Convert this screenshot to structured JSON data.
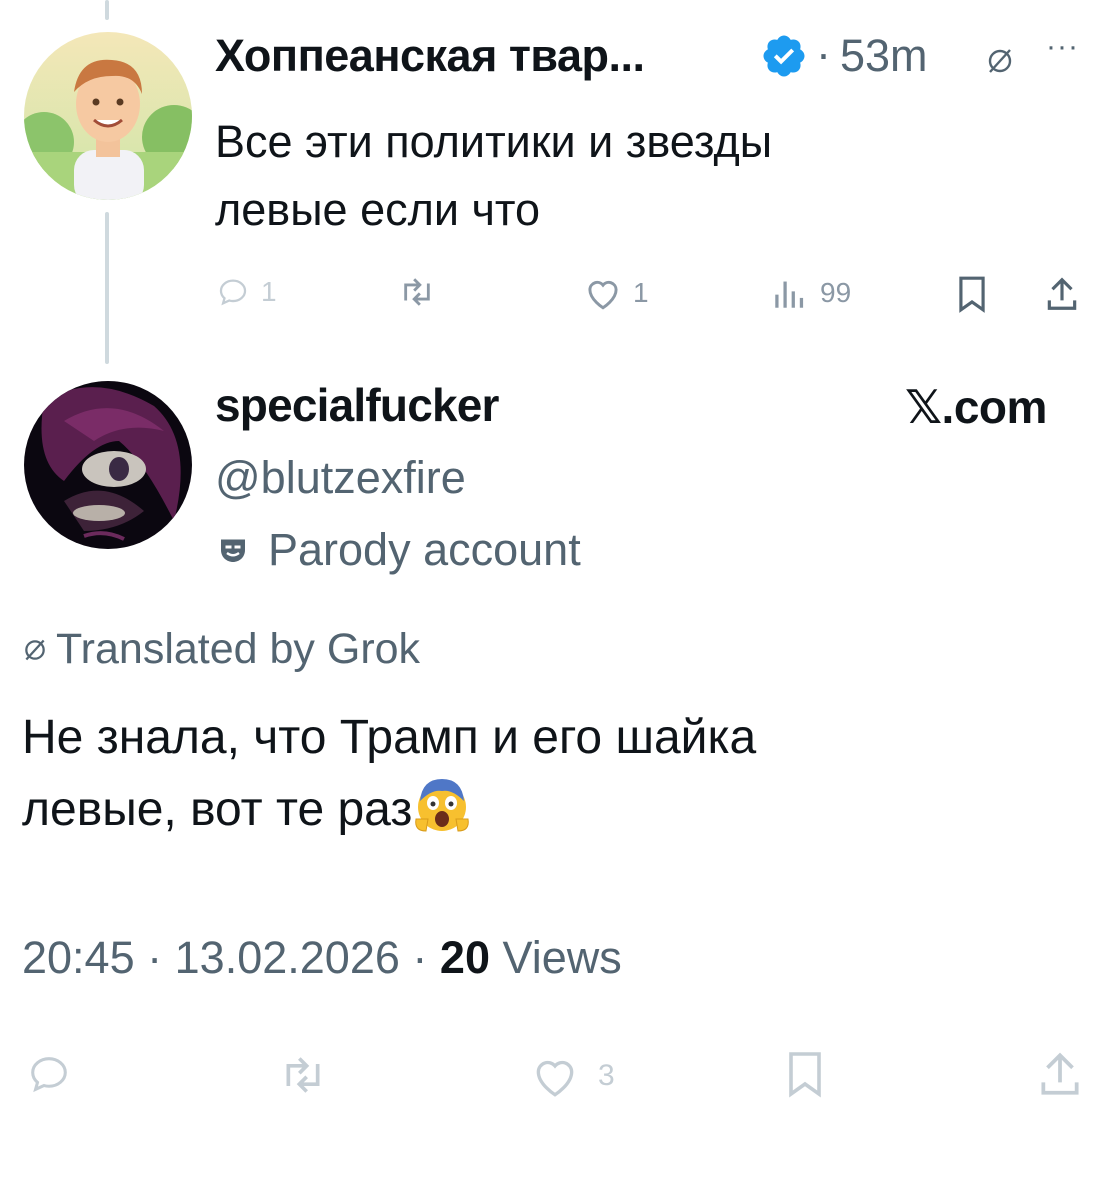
{
  "parent_tweet": {
    "author_name": "Хоппеанская твар...",
    "time": "53m",
    "separator": "·",
    "more": "···",
    "text_lines": [
      "Все эти политики и звезды",
      "левые если что"
    ],
    "actions": {
      "replies": "1",
      "retweets": "",
      "likes": "1",
      "views": "99"
    }
  },
  "reply_tweet": {
    "author_name": "specialfucker",
    "brand": "𝕏.com",
    "handle": "@blutzexfire",
    "parody_label": "Parody account",
    "translated_label": "Translated by Grok",
    "text_lines": [
      "Не знала, что Трамп и его шайка",
      "левые, вот те раз"
    ],
    "meta": {
      "time": "20:45",
      "date": "13.02.2026",
      "separator": "·",
      "views_count": "20",
      "views_label": "Views"
    },
    "actions": {
      "likes": "3"
    }
  },
  "colors": {
    "verified": "#1d9bf0",
    "secondary_text": "#536471",
    "action_gray": "#8b98a5"
  }
}
